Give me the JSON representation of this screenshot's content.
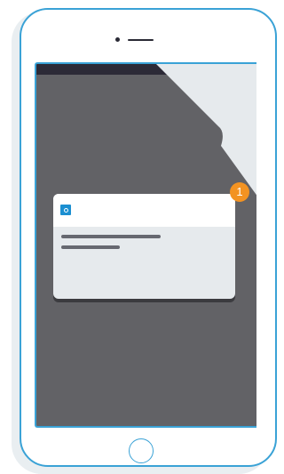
{
  "notification": {
    "badge_count": "1",
    "app_icon": "app-icon-square",
    "text_lines": 2
  },
  "colors": {
    "frame": "#3aa2d6",
    "screen": "#626266",
    "status_bar": "#2c2a37",
    "badge": "#f39322",
    "app_icon": "#1b8fd1"
  }
}
